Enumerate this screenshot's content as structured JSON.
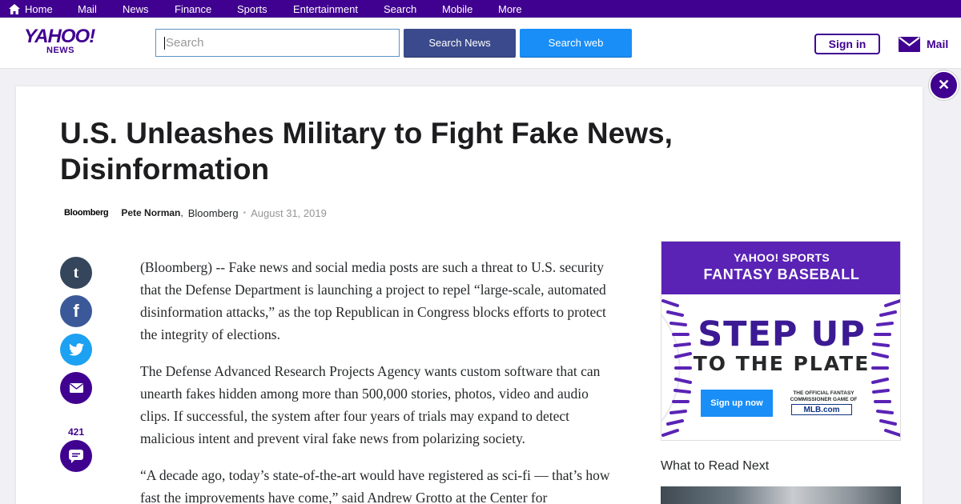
{
  "topnav": {
    "items": [
      {
        "label": "Home",
        "icon": "home-icon"
      },
      {
        "label": "Mail"
      },
      {
        "label": "News"
      },
      {
        "label": "Finance"
      },
      {
        "label": "Sports"
      },
      {
        "label": "Entertainment"
      },
      {
        "label": "Search"
      },
      {
        "label": "Mobile"
      },
      {
        "label": "More"
      }
    ]
  },
  "header": {
    "logo_main": "YAHOO!",
    "logo_sub": "NEWS",
    "search_placeholder": "Search",
    "search_news_label": "Search News",
    "search_web_label": "Search web",
    "signin_label": "Sign in",
    "mail_label": "Mail"
  },
  "article": {
    "title": "U.S. Unleashes Military to Fight Fake News, Disinformation",
    "provider_logo": "Bloomberg",
    "author": "Pete Norman",
    "source": "Bloomberg",
    "date": "August 31, 2019",
    "comment_count": "421",
    "paragraphs": [
      "(Bloomberg) -- Fake news and social media posts are such a threat to U.S. security that the Defense Department is launching a project to repel “large-scale, automated disinformation attacks,” as the top Republican in Congress blocks efforts to protect the integrity of elections.",
      "The Defense Advanced Research Projects Agency wants custom software that can unearth fakes hidden among more than 500,000 stories, photos, video and audio clips. If successful, the system after four years of trials may expand to detect malicious intent and prevent viral fake news from polarizing society.",
      "“A decade ago, today’s state-of-the-art would have registered as sci-fi — that’s how fast the improvements have come,” said Andrew Grotto at the Center for"
    ]
  },
  "ad": {
    "line1": "YAHOO! SPORTS",
    "line2": "FANTASY BASEBALL",
    "headline1": "STEP UP",
    "headline2": "TO THE PLATE",
    "cta": "Sign up now",
    "fine_print": "THE OFFICIAL FANTASY COMMISSIONER GAME OF",
    "mlb": "MLB.com"
  },
  "sidebar": {
    "read_next": "What to Read Next"
  },
  "colors": {
    "brand": "#400090",
    "search_news_bg": "#3b4a8c",
    "search_web_bg": "#198ef7"
  }
}
